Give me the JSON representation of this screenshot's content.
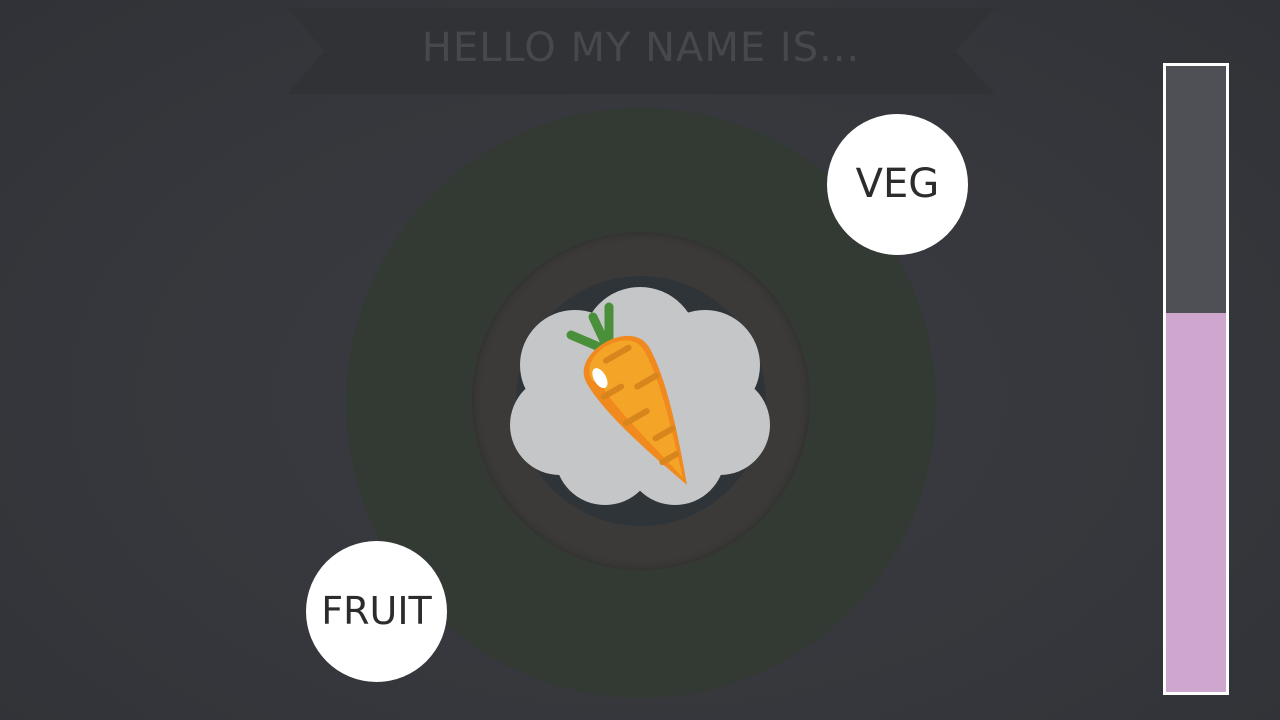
{
  "banner": {
    "text": "HELLO MY NAME IS..."
  },
  "item": {
    "icon": "carrot-icon"
  },
  "answers": {
    "veg_label": "VEG",
    "fruit_label": "FRUIT"
  },
  "meter": {
    "level": 0.605,
    "fill_color": "#cfa6cd",
    "track_color": "#4f5056"
  },
  "colors": {
    "background": "#36383e",
    "zone": "#323a33",
    "button": "#ffffff",
    "carrot": "#f0a024",
    "leaves": "#4a8f3a"
  }
}
